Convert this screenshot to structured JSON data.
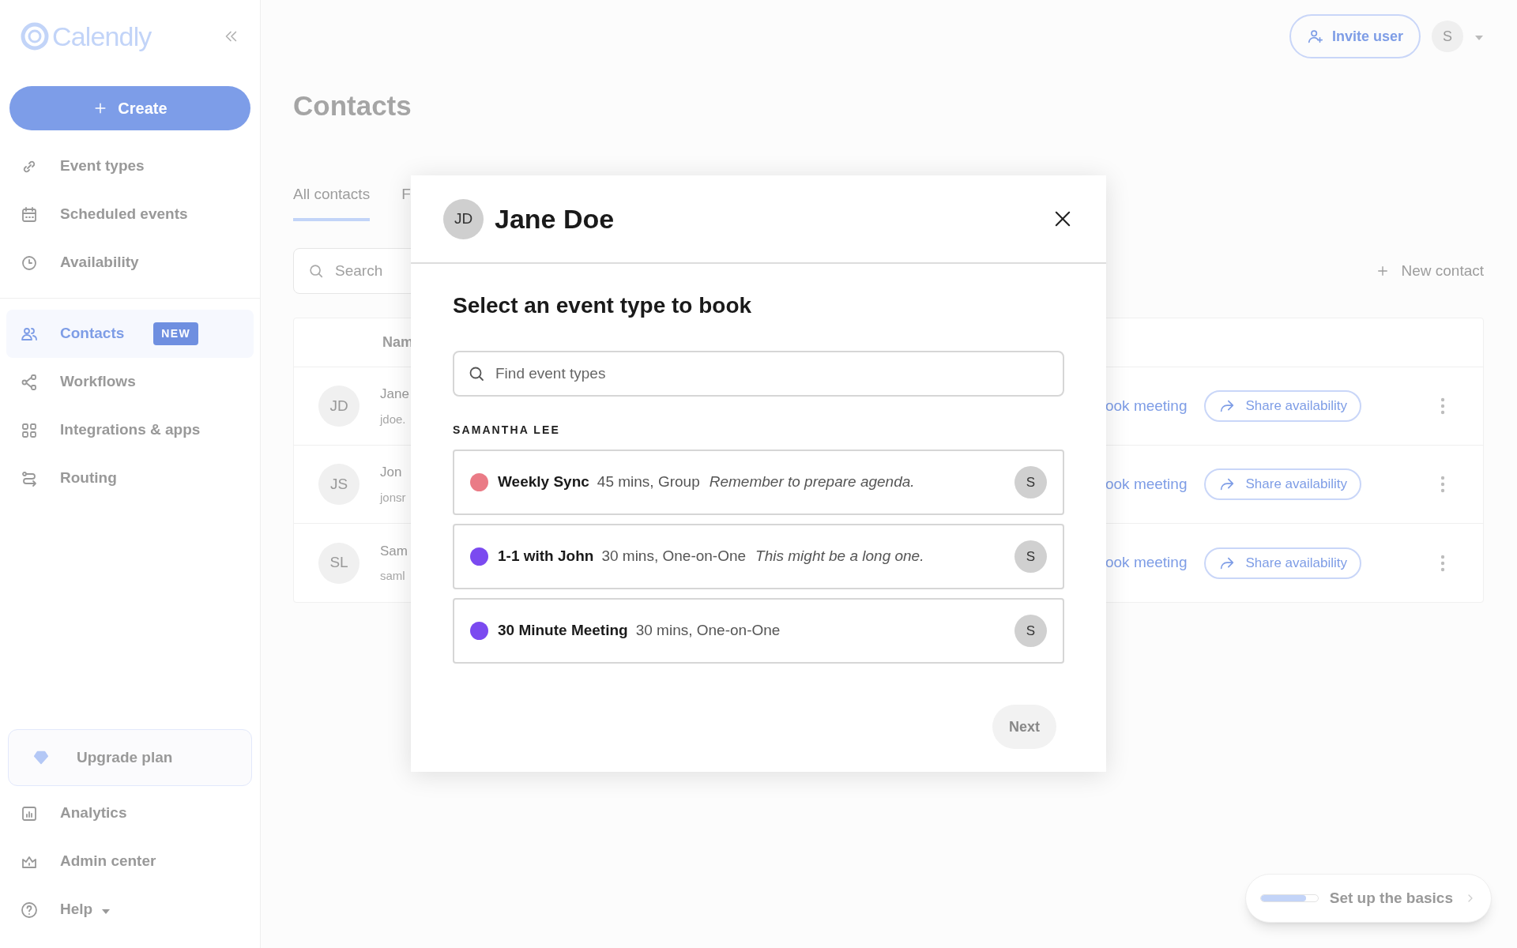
{
  "sidebar": {
    "logo": "Calendly",
    "create_button": "Create",
    "nav_top": [
      {
        "label": "Event types",
        "selected": false
      },
      {
        "label": "Scheduled events",
        "selected": false
      },
      {
        "label": "Availability",
        "selected": false
      }
    ],
    "nav_main": [
      {
        "label": "Contacts",
        "selected": true,
        "badge": "NEW"
      },
      {
        "label": "Workflows",
        "selected": false
      },
      {
        "label": "Integrations & apps",
        "selected": false
      },
      {
        "label": "Routing",
        "selected": false
      }
    ],
    "upgrade": "Upgrade plan",
    "nav_bottom": [
      {
        "label": "Analytics",
        "selected": false
      },
      {
        "label": "Admin center",
        "selected": false
      },
      {
        "label": "Help",
        "selected": false
      }
    ]
  },
  "header": {
    "invite_button": "Invite user",
    "avatar": "S"
  },
  "page": {
    "title": "Contacts",
    "tabs": [
      {
        "label": "All contacts",
        "selected": true
      },
      {
        "label": "F",
        "selected": false
      }
    ],
    "search": {
      "placeholder": "Search"
    },
    "new_contact": "New contact",
    "table": {
      "columns": [
        "Nam"
      ],
      "rows": [
        {
          "initials": "JD",
          "name": "Jane",
          "email": "jdoe.",
          "action": "ook meeting",
          "share": "Share availability"
        },
        {
          "initials": "JS",
          "name": "Jon",
          "email": "jonsr",
          "action": "ook meeting",
          "share": "Share availability"
        },
        {
          "initials": "SL",
          "name": "Sam",
          "email": "saml",
          "action": "ook meeting",
          "share": "Share availability"
        }
      ]
    }
  },
  "modal": {
    "avatar": "JD",
    "title": "Jane Doe",
    "heading": "Select an event type to book",
    "search": {
      "placeholder": "Find event types"
    },
    "owner": "SAMANTHA LEE",
    "events": [
      {
        "name": "Weekly Sync",
        "details": "45 mins, Group",
        "note": "Remember to prepare agenda.",
        "color": "#ea7b86",
        "host": "S"
      },
      {
        "name": "1-1 with John",
        "details": "30 mins, One-on-One",
        "note": "This might be a long one.",
        "color": "#7b4af0",
        "host": "S"
      },
      {
        "name": "30 Minute Meeting",
        "details": "30 mins, One-on-One",
        "color": "#7b4af0",
        "host": "S"
      }
    ],
    "next_button": "Next"
  },
  "setup": {
    "label": "Set up the basics",
    "level": 0.8
  }
}
